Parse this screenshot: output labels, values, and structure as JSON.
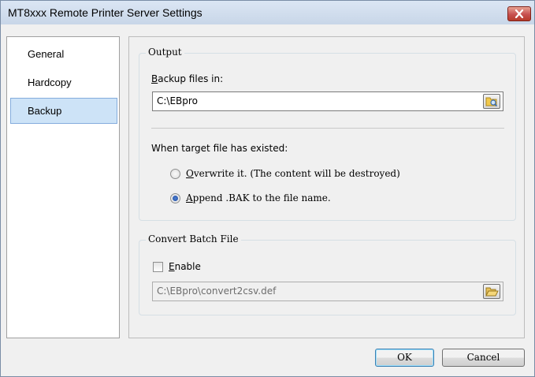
{
  "window": {
    "title": "MT8xxx Remote Printer Server Settings"
  },
  "sidebar": {
    "items": [
      {
        "label": "General",
        "selected": false
      },
      {
        "label": "Hardcopy",
        "selected": false
      },
      {
        "label": "Backup",
        "selected": true
      }
    ]
  },
  "output": {
    "group_label": "Output",
    "backup_label_accel": "B",
    "backup_label_rest": "ackup files in:",
    "path_value": "C:\\EBpro",
    "exists_label": "When target file has existed:",
    "overwrite_accel": "O",
    "overwrite_rest": "verwrite it. (The content will be destroyed)",
    "append_accel": "A",
    "append_rest": "ppend .BAK to the file name.",
    "selected_option": "append"
  },
  "convert": {
    "group_label": "Convert Batch File",
    "enable_accel": "E",
    "enable_rest": "nable",
    "enabled": false,
    "path_value": "C:\\EBpro\\convert2csv.def"
  },
  "buttons": {
    "ok": "OK",
    "cancel": "Cancel"
  }
}
